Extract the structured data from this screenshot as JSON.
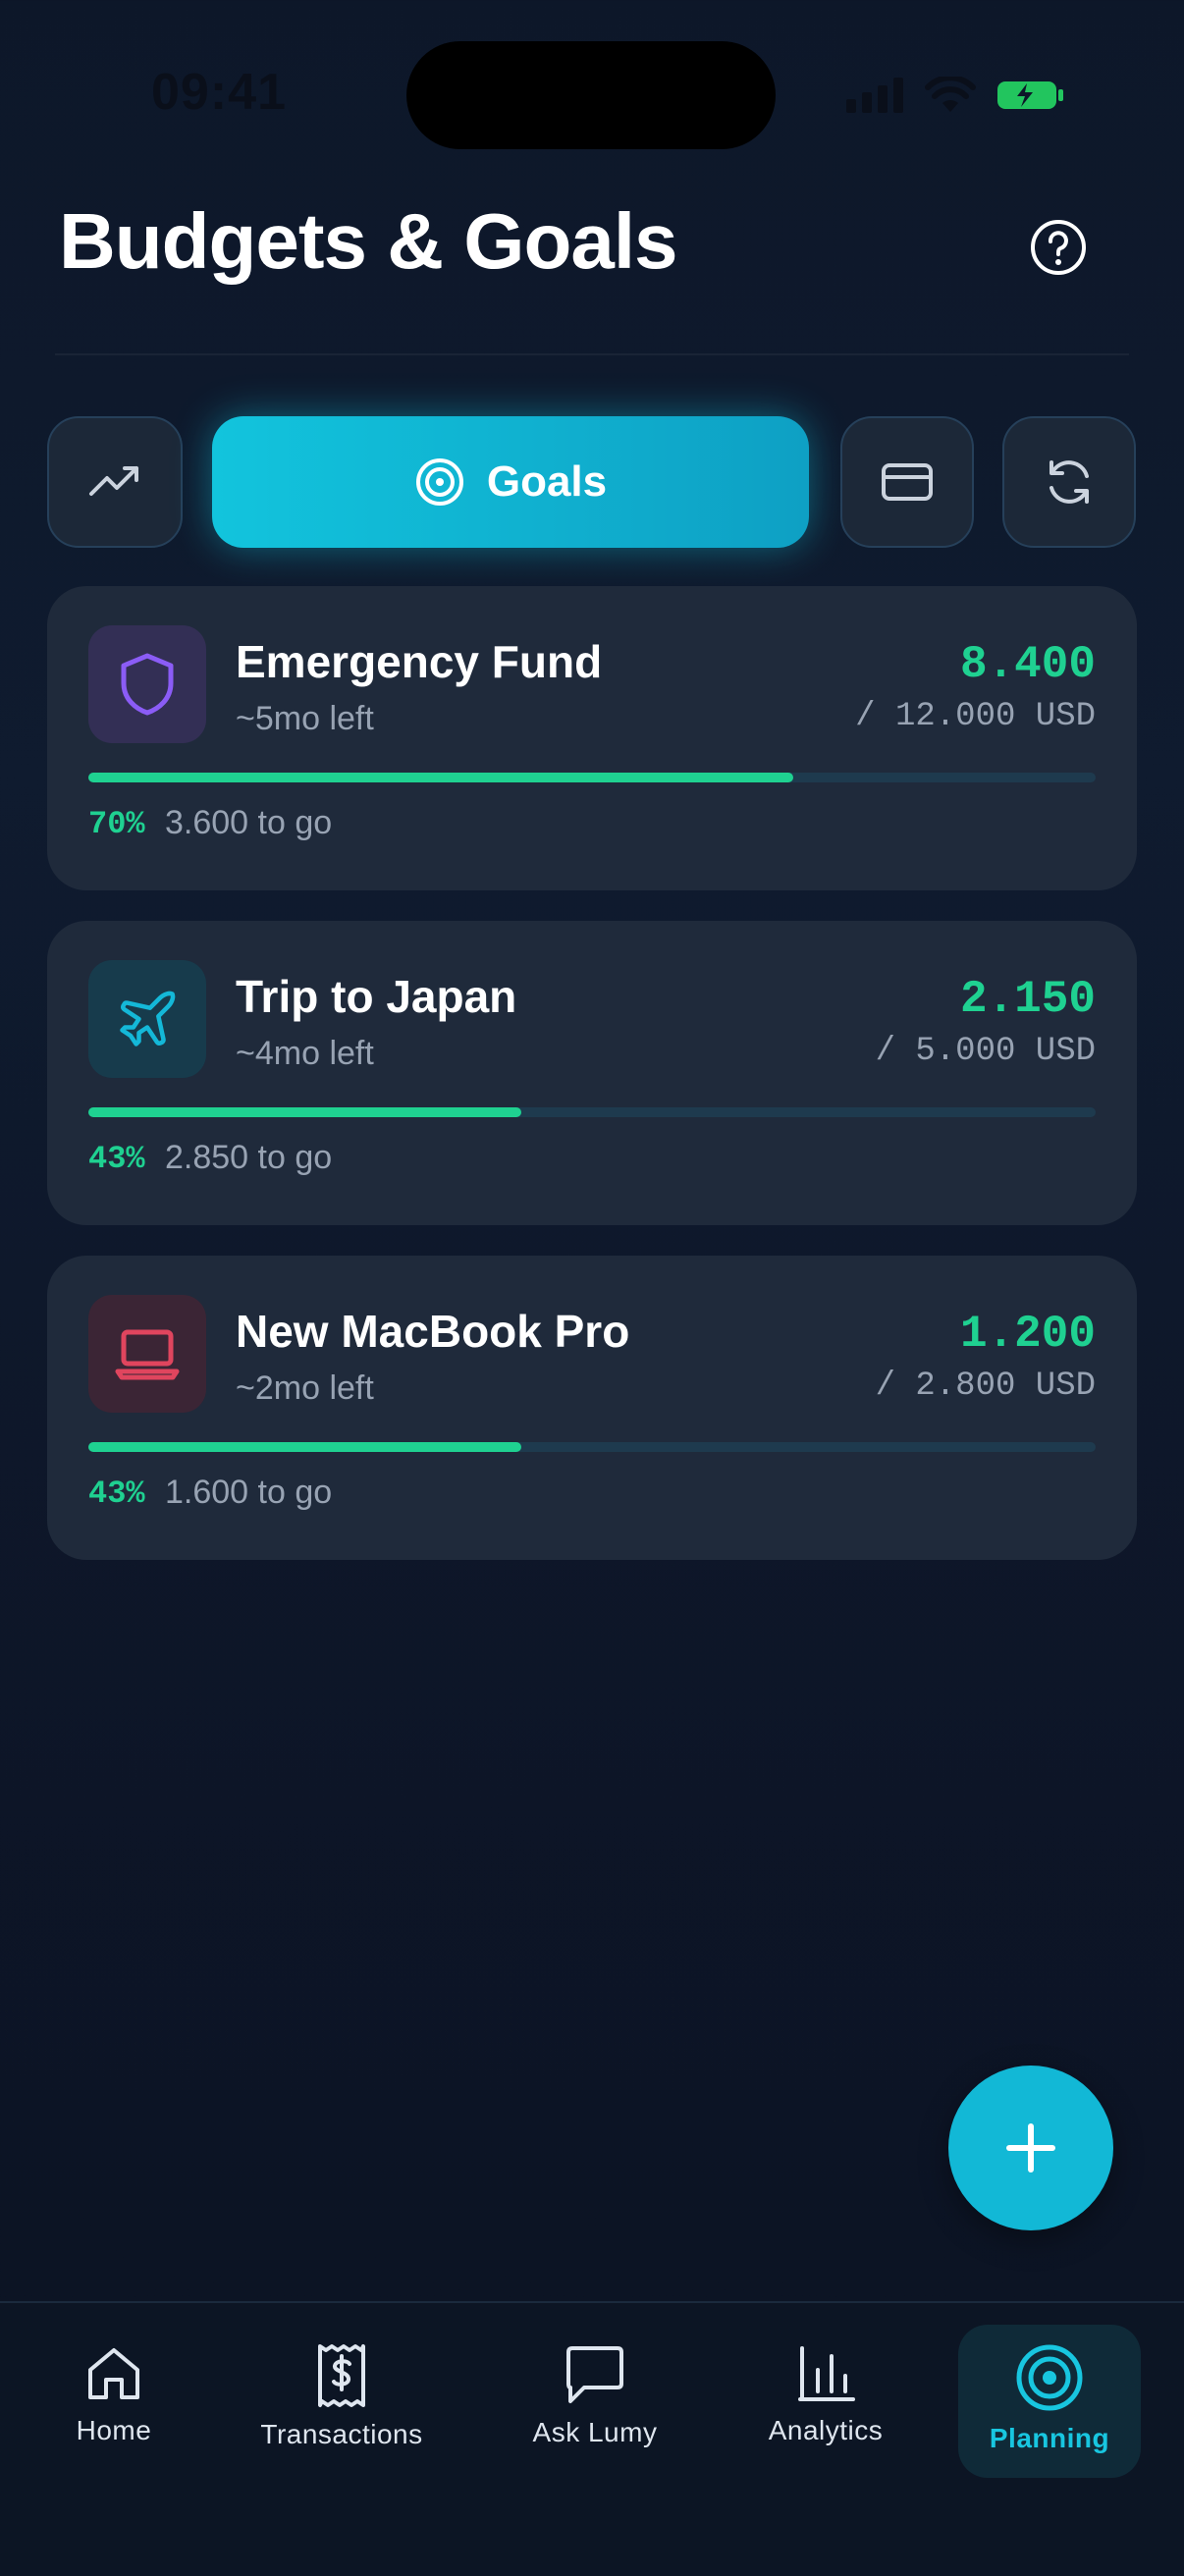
{
  "status_bar": {
    "time": "09:41"
  },
  "header": {
    "title": "Budgets & Goals"
  },
  "tabs": {
    "active_label": "Goals"
  },
  "goals": [
    {
      "name": "Emergency Fund",
      "time_left": "~5mo left",
      "saved": "8.400",
      "target": "/ 12.000 USD",
      "percent": "70%",
      "progress": 0.7,
      "to_go": "3.600 to go",
      "icon": "shield-icon",
      "icon_color": "#8b5cf6",
      "icon_bg": "#332f55"
    },
    {
      "name": "Trip to Japan",
      "time_left": "~4mo left",
      "saved": "2.150",
      "target": "/ 5.000 USD",
      "percent": "43%",
      "progress": 0.43,
      "to_go": "2.850 to go",
      "icon": "plane-icon",
      "icon_color": "#14b8d8",
      "icon_bg": "#173b4c"
    },
    {
      "name": "New MacBook Pro",
      "time_left": "~2mo left",
      "saved": "1.200",
      "target": "/ 2.800 USD",
      "percent": "43%",
      "progress": 0.43,
      "to_go": "1.600 to go",
      "icon": "laptop-icon",
      "icon_color": "#e0455e",
      "icon_bg": "#3b2535"
    }
  ],
  "nav": {
    "home": "Home",
    "transactions": "Transactions",
    "ask": "Ask Lumy",
    "analytics": "Analytics",
    "planning": "Planning"
  },
  "colors": {
    "accent": "#12c4dd",
    "progress": "#1fd191"
  }
}
